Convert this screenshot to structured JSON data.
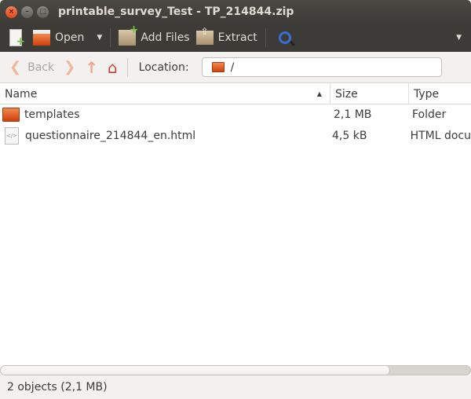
{
  "window": {
    "title": "printable_survey_Test - TP_214844.zip"
  },
  "toolbar": {
    "open_label": "Open",
    "add_files_label": "Add Files",
    "extract_label": "Extract"
  },
  "nav": {
    "back_label": "Back",
    "location_label": "Location:",
    "location_value": "/"
  },
  "columns": {
    "name": "Name",
    "size": "Size",
    "type": "Type"
  },
  "files": [
    {
      "name": "templates",
      "size": "2,1 MB",
      "type": "Folder",
      "icon": "folder-icon"
    },
    {
      "name": "questionnaire_214844_en.html",
      "size": "4,5 kB",
      "type": "HTML docu",
      "icon": "html-file-icon"
    }
  ],
  "scrollbar": {
    "horizontal_visible_fraction": 0.83
  },
  "status": {
    "text": "2 objects (2,1 MB)"
  }
}
